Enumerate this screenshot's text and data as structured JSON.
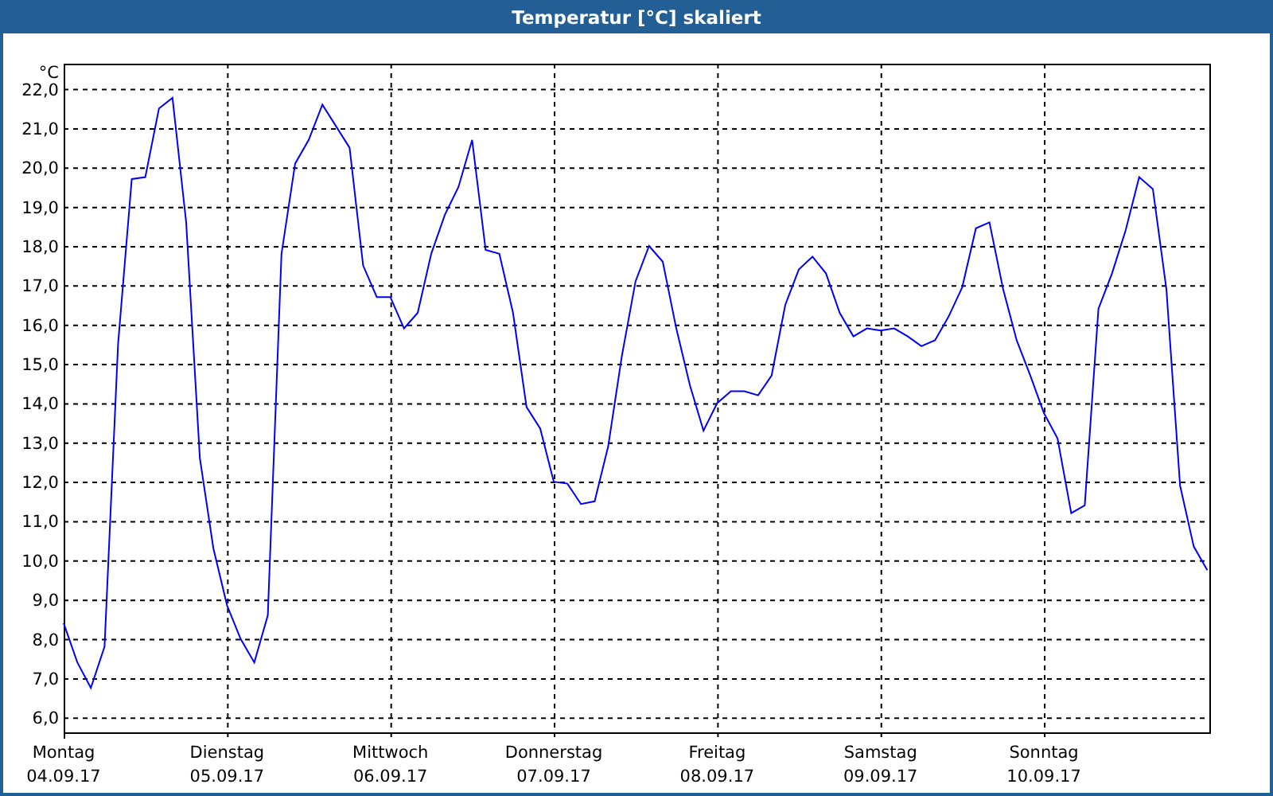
{
  "window": {
    "title": "Temperatur [°C] skaliert"
  },
  "chart": {
    "date_labels": [
      "04.09.17",
      "05.09.17",
      "06.09.17",
      "07.09.17",
      "08.09.17",
      "09.09.17",
      "10.09.17"
    ],
    "chart_data": {
      "type": "line",
      "ylabel": "°C",
      "grid": true,
      "ylim": [
        5.62,
        22.64
      ],
      "yticks": [
        {
          "value": 6,
          "label": "6,0"
        },
        {
          "value": 7,
          "label": "7,0"
        },
        {
          "value": 8,
          "label": "8,0"
        },
        {
          "value": 9,
          "label": "9,0"
        },
        {
          "value": 10,
          "label": "10,0"
        },
        {
          "value": 11,
          "label": "11,0"
        },
        {
          "value": 12,
          "label": "12,0"
        },
        {
          "value": 13,
          "label": "13,0"
        },
        {
          "value": 14,
          "label": "14,0"
        },
        {
          "value": 15,
          "label": "15,0"
        },
        {
          "value": 16,
          "label": "16,0"
        },
        {
          "value": 17,
          "label": "17,0"
        },
        {
          "value": 18,
          "label": "18,0"
        },
        {
          "value": 19,
          "label": "19,0"
        },
        {
          "value": 20,
          "label": "20,0"
        },
        {
          "value": 21,
          "label": "21,0"
        },
        {
          "value": 22,
          "label": "22,0"
        }
      ],
      "categories": [
        "Montag",
        null,
        null,
        null,
        null,
        null,
        null,
        null,
        null,
        null,
        null,
        null,
        "Dienstag",
        null,
        null,
        null,
        null,
        null,
        null,
        null,
        null,
        null,
        null,
        null,
        "Mittwoch",
        null,
        null,
        null,
        null,
        null,
        null,
        null,
        null,
        null,
        null,
        null,
        "Donnerstag",
        null,
        null,
        null,
        null,
        null,
        null,
        null,
        null,
        null,
        null,
        null,
        "Freitag",
        null,
        null,
        null,
        null,
        null,
        null,
        null,
        null,
        null,
        null,
        null,
        "Samstag",
        null,
        null,
        null,
        null,
        null,
        null,
        null,
        null,
        null,
        null,
        null,
        "Sonntag",
        null,
        null,
        null,
        null,
        null,
        null,
        null,
        null,
        null,
        null,
        null,
        null
      ],
      "series": [
        {
          "color": "#0000ff",
          "values": [
            8.4,
            7.4,
            6.75,
            7.8,
            15.5,
            19.7,
            19.75,
            21.5,
            21.77,
            18.6,
            12.6,
            10.3,
            8.85,
            8.0,
            7.4,
            8.6,
            17.8,
            20.1,
            20.7,
            21.6,
            21.05,
            20.5,
            17.5,
            16.7,
            16.7,
            15.9,
            16.3,
            17.8,
            18.8,
            19.5,
            20.7,
            17.9,
            17.8,
            16.3,
            13.9,
            13.35,
            12.0,
            11.95,
            11.43,
            11.5,
            12.9,
            15.2,
            17.1,
            18.0,
            17.6,
            15.9,
            14.45,
            13.3,
            14.0,
            14.3,
            14.3,
            14.2,
            14.7,
            16.5,
            17.4,
            17.73,
            17.3,
            16.3,
            15.7,
            15.9,
            15.85,
            15.9,
            15.7,
            15.45,
            15.6,
            16.2,
            16.95,
            18.45,
            18.6,
            16.9,
            15.6,
            14.7,
            13.75,
            13.1,
            11.2,
            11.4,
            16.4,
            17.3,
            18.4,
            19.75,
            19.45,
            16.9,
            11.9,
            10.35,
            9.75
          ]
        }
      ]
    }
  }
}
